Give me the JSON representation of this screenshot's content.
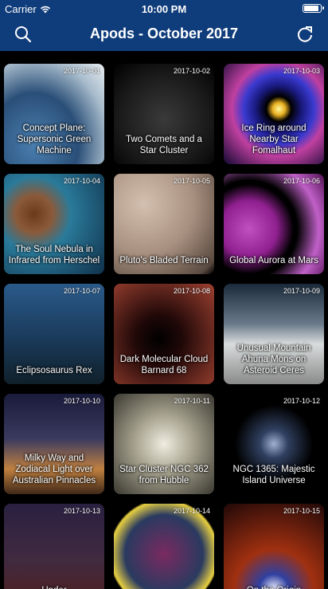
{
  "status": {
    "carrier": "Carrier",
    "time": "10:00 PM",
    "battery_level": 0.95
  },
  "nav": {
    "title": "Apods - October 2017",
    "search_icon": "search-icon",
    "refresh_icon": "refresh-icon"
  },
  "tiles": [
    {
      "date": "2017-10-01",
      "title": "Concept Plane: Supersonic Green Machine"
    },
    {
      "date": "2017-10-02",
      "title": "Two Comets and a Star Cluster"
    },
    {
      "date": "2017-10-03",
      "title": "Ice Ring around Nearby Star Fomalhaut"
    },
    {
      "date": "2017-10-04",
      "title": "The Soul Nebula in Infrared from Herschel"
    },
    {
      "date": "2017-10-05",
      "title": "Pluto's Bladed Terrain"
    },
    {
      "date": "2017-10-06",
      "title": "Global Aurora at Mars"
    },
    {
      "date": "2017-10-07",
      "title": "Eclipsosaurus Rex"
    },
    {
      "date": "2017-10-08",
      "title": "Dark Molecular Cloud Barnard 68"
    },
    {
      "date": "2017-10-09",
      "title": "Unusual Mountain Ahuna Mons on Asteroid Ceres"
    },
    {
      "date": "2017-10-10",
      "title": "Milky Way and Zodiacal Light over Australian Pinnacles"
    },
    {
      "date": "2017-10-11",
      "title": "Star Cluster NGC 362 from Hubble"
    },
    {
      "date": "2017-10-12",
      "title": "NGC 1365: Majestic Island Universe"
    },
    {
      "date": "2017-10-13",
      "title": "Under"
    },
    {
      "date": "2017-10-14",
      "title": ""
    },
    {
      "date": "2017-10-15",
      "title": "On the Origin"
    }
  ]
}
